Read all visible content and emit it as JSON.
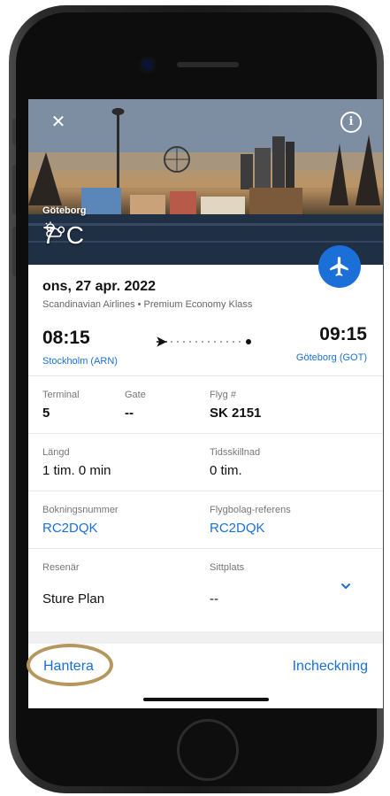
{
  "hero": {
    "city": "Göteborg",
    "temperature": "7°C",
    "weather_icon": "partly-cloudy-icon",
    "close_icon": "close-icon",
    "info_icon": "info-icon"
  },
  "flight": {
    "date": "ons, 27 apr. 2022",
    "airline": "Scandinavian Airlines • Premium Economy Klass",
    "departure_time": "08:15",
    "departure_city": "Stockholm (ARN)",
    "arrival_time": "09:15",
    "arrival_city": "Göteborg (GOT)"
  },
  "details": {
    "terminal_label": "Terminal",
    "terminal_value": "5",
    "gate_label": "Gate",
    "gate_value": "--",
    "flight_no_label": "Flyg #",
    "flight_no_value": "SK 2151",
    "duration_label": "Längd",
    "duration_value": "1 tim. 0 min",
    "time_diff_label": "Tidsskillnad",
    "time_diff_value": "0 tim.",
    "booking_label": "Bokningsnummer",
    "booking_value": "RC2DQK",
    "airline_ref_label": "Flygbolag-referens",
    "airline_ref_value": "RC2DQK",
    "traveler_label": "Resenär",
    "traveler_value": "Sture Plan",
    "seat_label": "Sittplats",
    "seat_value": "--"
  },
  "actions": {
    "manage_label": "Hantera",
    "checkin_label": "Incheckning"
  },
  "colors": {
    "accent": "#1a6fd8",
    "highlight_ring": "#b5965d"
  }
}
